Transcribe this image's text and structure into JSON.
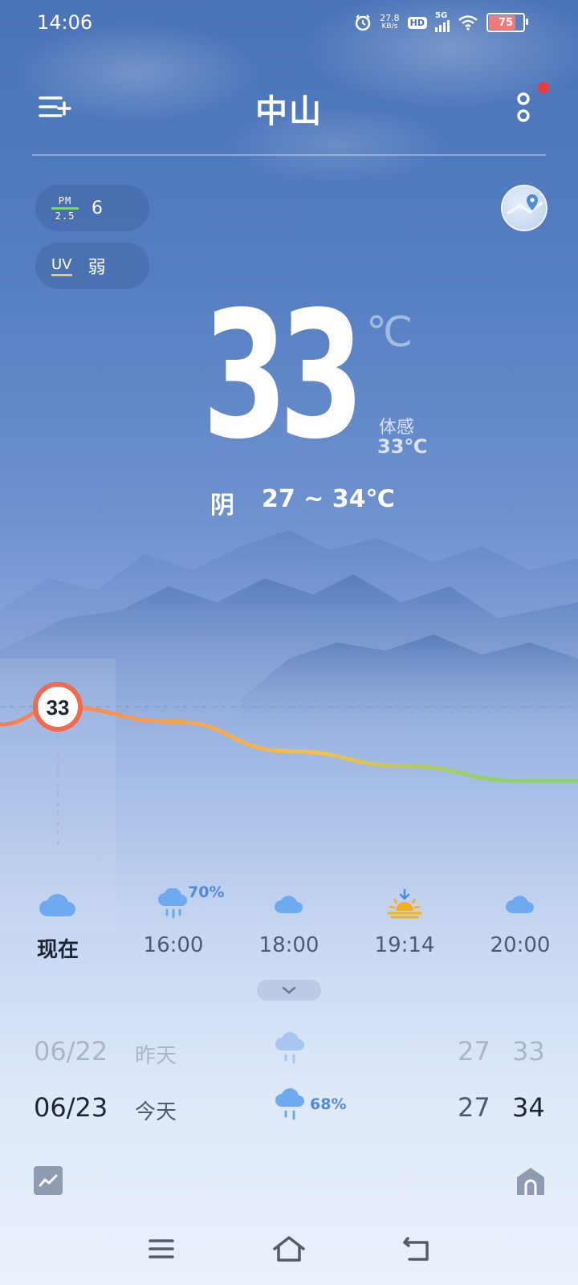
{
  "status_bar": {
    "time": "14:06",
    "net_speed_value": "27.8",
    "net_speed_unit": "KB/s",
    "hd": "HD",
    "network": "5G",
    "battery": "75",
    "icons": [
      "alarm-icon",
      "hd-icon",
      "5g-signal-icon",
      "wifi-icon",
      "battery-icon"
    ]
  },
  "header": {
    "city": "中山",
    "menu_icon": "add-city-menu-icon",
    "more_icon": "more-vertical-icon",
    "notification_dot_color": "#f03a3a"
  },
  "chips": {
    "pm_label_top": "PM",
    "pm_label_bottom": "2.5",
    "pm_value": "6",
    "uv_label": "UV",
    "uv_value": "弱"
  },
  "current": {
    "temp": "33",
    "unit": "℃",
    "feel_label": "体感",
    "feel_value": "33℃",
    "condition": "阴",
    "range": "27 ~ 34℃"
  },
  "chart": {
    "current_label": "33",
    "line_colors": [
      "#ff7a4d",
      "#f2c14e",
      "#8fd16a"
    ]
  },
  "chart_data": {
    "type": "line",
    "x": [
      "现在",
      "16:00",
      "18:00",
      "19:14",
      "20:00"
    ],
    "series": [
      {
        "values": [
          33,
          32,
          30,
          29,
          28
        ]
      }
    ]
  },
  "hourly": [
    {
      "label": "现在",
      "icon": "cloudy-icon",
      "pct": ""
    },
    {
      "label": "16:00",
      "icon": "rain-icon",
      "pct": "70%"
    },
    {
      "label": "18:00",
      "icon": "cloudy-icon",
      "pct": ""
    },
    {
      "label": "19:14",
      "icon": "sunset-icon",
      "pct": ""
    },
    {
      "label": "20:00",
      "icon": "cloudy-icon",
      "pct": ""
    }
  ],
  "daily": [
    {
      "date": "06/22",
      "name": "昨天",
      "icon": "rain-icon",
      "pct": "",
      "low": "27",
      "high": "33"
    },
    {
      "date": "06/23",
      "name": "今天",
      "icon": "rain-icon",
      "pct": "68%",
      "low": "27",
      "high": "34"
    }
  ],
  "bottom": {
    "trend_icon": "trend-chart-icon",
    "home_icon": "home-card-icon"
  },
  "nav": {
    "icons": [
      "menu-icon",
      "home-icon",
      "back-icon"
    ]
  }
}
